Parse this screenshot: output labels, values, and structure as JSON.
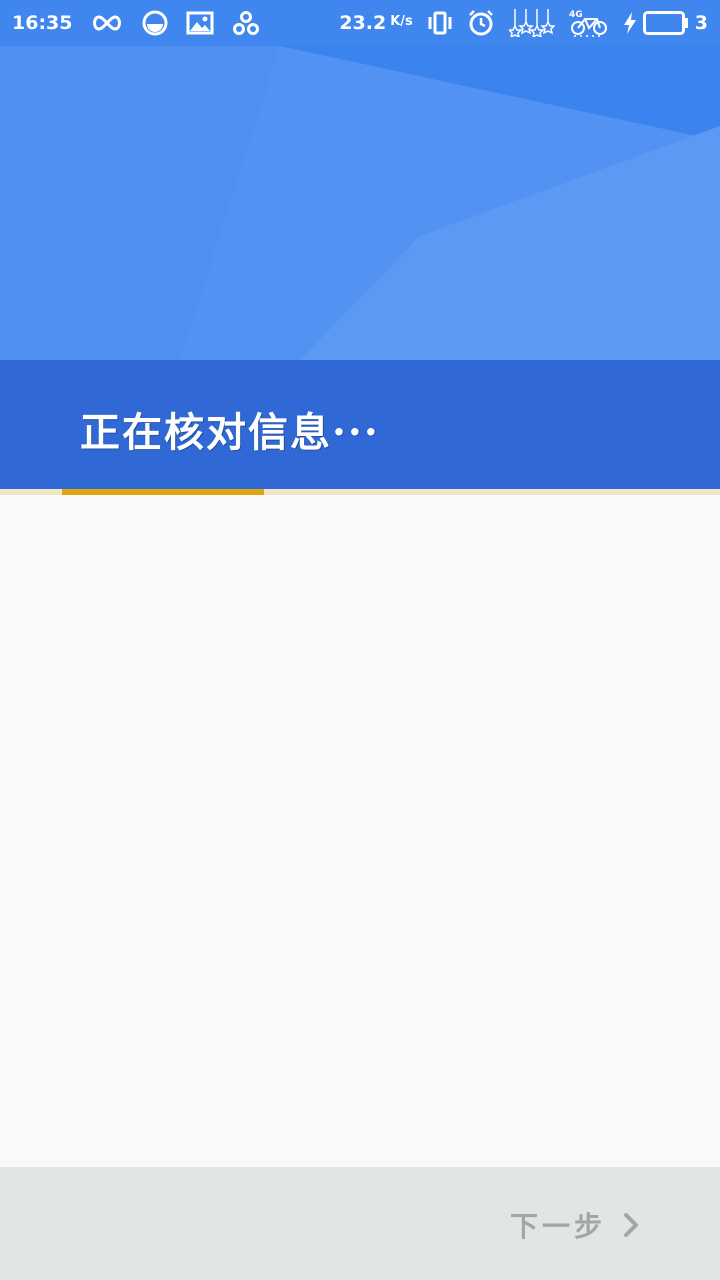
{
  "status_bar": {
    "time": "16:35",
    "net_speed_value": "23.2",
    "net_speed_unit": "K/s",
    "battery_level": "3",
    "icons": [
      "infinity-icon",
      "browser-icon",
      "gallery-icon",
      "share-icon",
      "vibrate-icon",
      "alarm-icon",
      "hanging-stars-icon",
      "4g-bike-icon",
      "charging-bolt-icon",
      "battery-icon"
    ]
  },
  "header": {
    "title": "正在核对信息···"
  },
  "progress": {
    "fraction": 0.28,
    "color": "#e0a514"
  },
  "footer": {
    "next_label": "下一步"
  },
  "colors": {
    "status_bar": "#3f86ef",
    "banner": "#4a8cf0",
    "band": "#3069d6",
    "bottom_bar": "#e2e5e6",
    "disabled_text": "#a3a5a7"
  }
}
